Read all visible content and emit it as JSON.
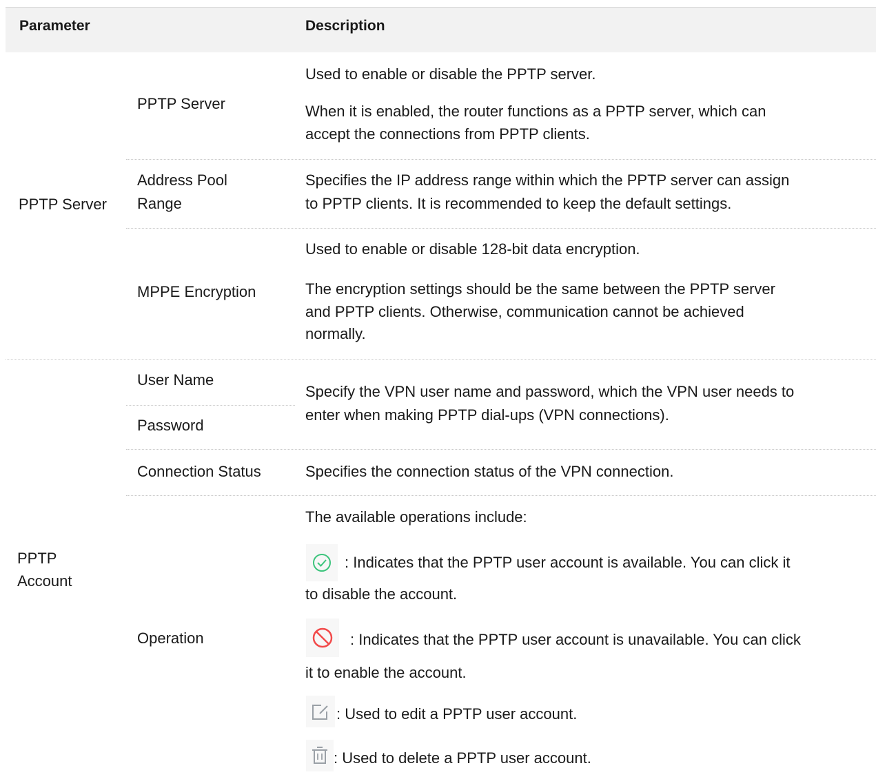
{
  "header": {
    "parameter": "Parameter",
    "description": "Description"
  },
  "pptp_server": {
    "group": "PPTP Server",
    "rows": [
      {
        "param": "PPTP Server",
        "desc": [
          "Used to enable or disable the PPTP server.",
          "When it is enabled, the router functions as a PPTP server, which can",
          "accept the connections from PPTP clients."
        ]
      },
      {
        "param_lines": [
          "Address Pool",
          "Range"
        ],
        "desc": [
          "Specifies the IP address range within which the PPTP server can assign",
          "to PPTP clients. It is recommended to keep the default settings."
        ]
      },
      {
        "param": "MPPE Encryption",
        "desc": [
          "Used to enable or disable 128-bit data encryption.",
          "The encryption settings should be the same between the PPTP server",
          "and PPTP clients. Otherwise, communication cannot be achieved",
          "normally."
        ]
      }
    ]
  },
  "pptp_account": {
    "group_lines": [
      "PPTP",
      "Account"
    ],
    "user_name": "User Name",
    "password": "Password",
    "cred_desc": [
      "Specify the VPN user name and password, which the VPN user needs to",
      "enter when making PPTP dial-ups (VPN connections)."
    ],
    "conn_status": "Connection Status",
    "conn_status_desc": "Specifies the connection status of the VPN connection.",
    "operation": "Operation",
    "op_intro": "The available operations include:",
    "op_available": [
      ": Indicates that the PPTP user account is available. You can click it",
      "to disable the account."
    ],
    "op_unavailable": [
      ": Indicates that the PPTP user account is unavailable. You can click",
      "it to enable the account."
    ],
    "op_edit": ": Used to edit a PPTP user account.",
    "op_delete": ": Used to delete a PPTP user account.",
    "icons": {
      "available": "check-circle-icon",
      "unavailable": "prohibited-icon",
      "edit": "edit-icon",
      "delete": "trash-icon"
    },
    "colors": {
      "available": "#3cc47c",
      "unavailable": "#f24a4a",
      "neutral": "#9aa0a6"
    }
  }
}
